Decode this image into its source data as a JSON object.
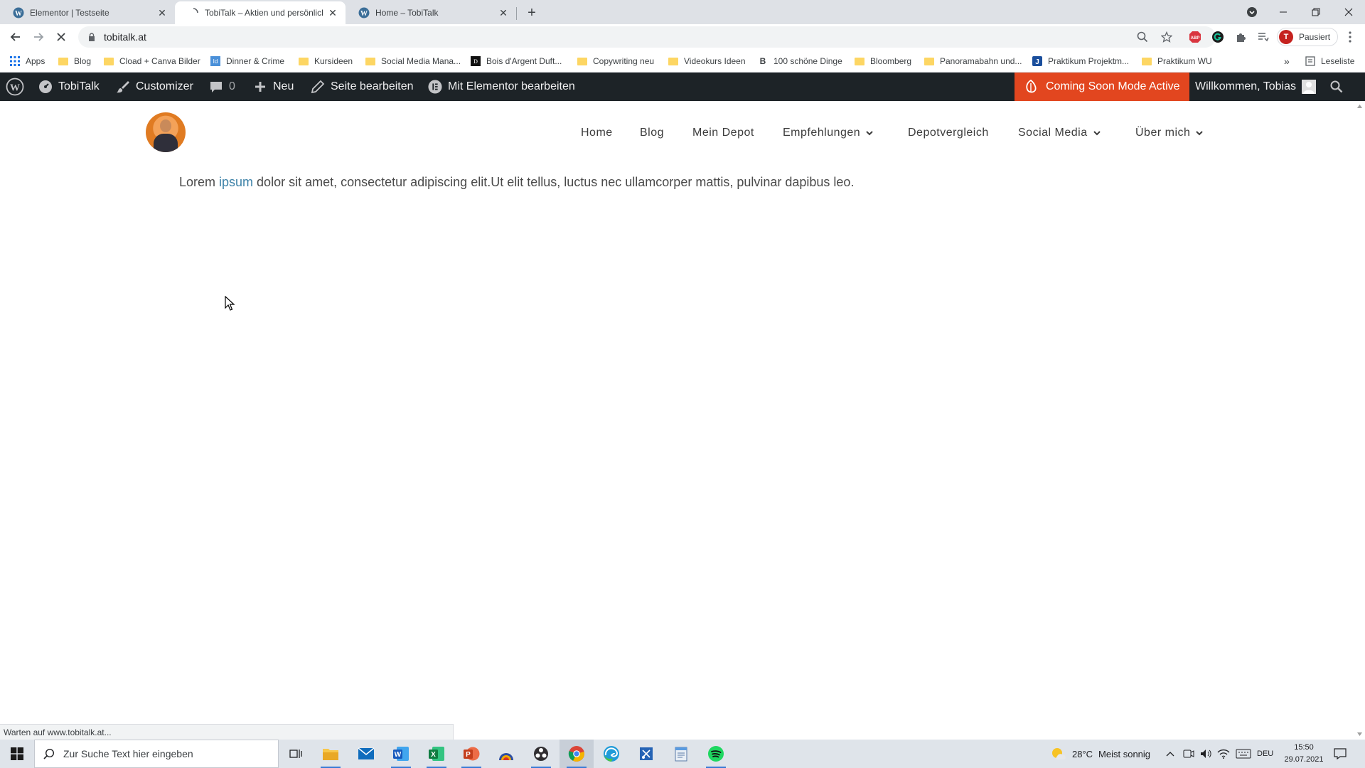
{
  "browser": {
    "tabs": [
      {
        "title": "Elementor | Testseite",
        "favicon": "wordpress-icon",
        "active": false
      },
      {
        "title": "TobiTalk – Aktien und persönlich",
        "favicon": "loading-icon",
        "active": true
      },
      {
        "title": "Home – TobiTalk",
        "favicon": "wordpress-icon",
        "active": false
      }
    ],
    "url": "tobitalk.at",
    "profile_initial": "T",
    "profile_label": "Pausiert",
    "extensions": [
      "abp-icon",
      "grammarly-icon",
      "extensions-puzzle-icon",
      "reading-list-icon"
    ],
    "bookmarks": [
      {
        "label": "Apps",
        "icon": "apps-grid-icon"
      },
      {
        "label": "Blog",
        "icon": "folder-icon"
      },
      {
        "label": "Cload + Canva Bilder",
        "icon": "folder-icon"
      },
      {
        "label": "Dinner & Crime",
        "icon": "site-icon"
      },
      {
        "label": "Kursideen",
        "icon": "folder-icon"
      },
      {
        "label": "Social Media Mana...",
        "icon": "folder-icon"
      },
      {
        "label": "Bois d'Argent Duft...",
        "icon": "site-icon"
      },
      {
        "label": "Copywriting neu",
        "icon": "folder-icon"
      },
      {
        "label": "Videokurs Ideen",
        "icon": "folder-icon"
      },
      {
        "label": "100 schöne Dinge",
        "icon": "b-icon"
      },
      {
        "label": "Bloomberg",
        "icon": "folder-icon"
      },
      {
        "label": "Panoramabahn und...",
        "icon": "folder-icon"
      },
      {
        "label": "Praktikum Projektm...",
        "icon": "j-icon"
      },
      {
        "label": "Praktikum WU",
        "icon": "folder-icon"
      }
    ],
    "overflow_label": "»",
    "reading_list_label": "Leseliste",
    "status_text": "Warten auf www.tobitalk.at..."
  },
  "wp_admin_bar": {
    "site_name": "TobiTalk",
    "customizer": "Customizer",
    "comments_count": "0",
    "new": "Neu",
    "edit_page": "Seite bearbeiten",
    "elementor_edit": "Mit Elementor bearbeiten",
    "coming_soon": "Coming Soon Mode Active",
    "welcome": "Willkommen, Tobias"
  },
  "site": {
    "nav": [
      {
        "label": "Home",
        "dropdown": false
      },
      {
        "label": "Blog",
        "dropdown": false
      },
      {
        "label": "Mein Depot",
        "dropdown": false
      },
      {
        "label": "Empfehlungen",
        "dropdown": true
      },
      {
        "label": "Depotvergleich",
        "dropdown": false
      },
      {
        "label": "Social Media",
        "dropdown": true
      },
      {
        "label": "Über mich",
        "dropdown": true
      }
    ],
    "text_before": "Lorem ",
    "text_highlight": "ipsum",
    "text_after": " dolor sit amet, consectetur adipiscing elit.Ut elit tellus, luctus nec ullamcorper mattis, pulvinar dapibus leo."
  },
  "taskbar": {
    "search_placeholder": "Zur Suche Text hier eingeben",
    "weather_temp": "28°C",
    "weather_text": "Meist sonnig",
    "language": "DEU",
    "time": "15:50",
    "date": "29.07.2021"
  },
  "colors": {
    "wp_bar": "#1d2327",
    "coming_soon": "#e2461f",
    "link": "#3d82a8"
  }
}
